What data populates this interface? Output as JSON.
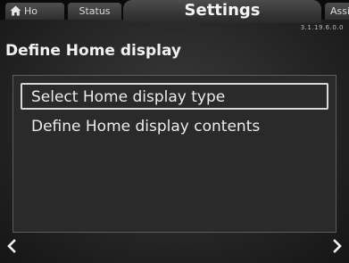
{
  "tabs": {
    "home": {
      "label": "Ho",
      "icon": "home-icon"
    },
    "status": {
      "label": "Status"
    },
    "settings": {
      "label": "Settings"
    },
    "assist": {
      "label": "Assist"
    }
  },
  "header": {
    "version": "3.1.19.6.0.0",
    "title": "Define Home display"
  },
  "menu": {
    "items": [
      {
        "label": "Select Home display type",
        "selected": true
      },
      {
        "label": "Define Home display contents",
        "selected": false
      }
    ]
  },
  "navigation": {
    "back_icon": "chevron-left-icon",
    "forward_icon": "chevron-right-icon"
  },
  "colors": {
    "background": "#262626",
    "text": "#ececec",
    "selection_border": "#d8d8d8"
  }
}
